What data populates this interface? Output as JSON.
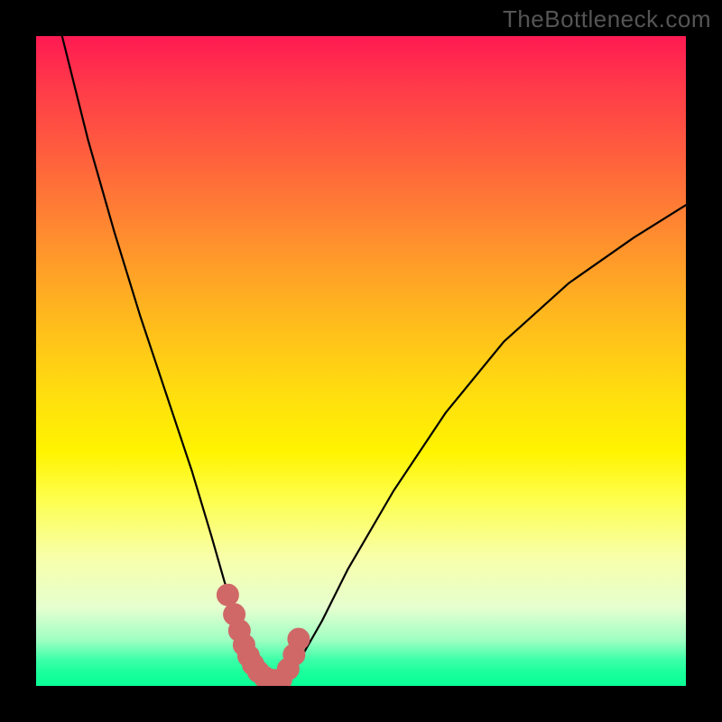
{
  "watermark": "TheBottleneck.com",
  "colors": {
    "page_bg": "#000000",
    "curve_stroke": "#000000",
    "marker_fill": "#d06868",
    "marker_stroke": "#d06868"
  },
  "chart_data": {
    "type": "line",
    "title": "",
    "xlabel": "",
    "ylabel": "",
    "xlim": [
      0,
      100
    ],
    "ylim": [
      0,
      100
    ],
    "grid": false,
    "note": "No axes, tick labels, or numeric annotations are visible; curve values are estimated in relative (0-100) plot coordinates.",
    "series": [
      {
        "name": "curve",
        "x": [
          4,
          8,
          12,
          16,
          20,
          24,
          27,
          29,
          31,
          32.5,
          34,
          36,
          37.5,
          40,
          44,
          48,
          55,
          63,
          72,
          82,
          92,
          100
        ],
        "y": [
          100,
          84,
          70,
          57,
          45,
          33,
          23,
          16,
          10,
          6,
          3,
          0.5,
          0.5,
          3,
          10,
          18,
          30,
          42,
          53,
          62,
          69,
          74
        ]
      }
    ],
    "markers": {
      "name": "highlighted-segment",
      "x": [
        29.5,
        30.5,
        31.3,
        32.0,
        32.7,
        33.4,
        34.2,
        35.2,
        36.3,
        37.7,
        38.8,
        39.7,
        40.4
      ],
      "y": [
        14.0,
        11.0,
        8.5,
        6.3,
        4.6,
        3.3,
        2.2,
        1.3,
        0.9,
        1.0,
        2.6,
        4.8,
        7.2
      ],
      "size": 12
    }
  }
}
